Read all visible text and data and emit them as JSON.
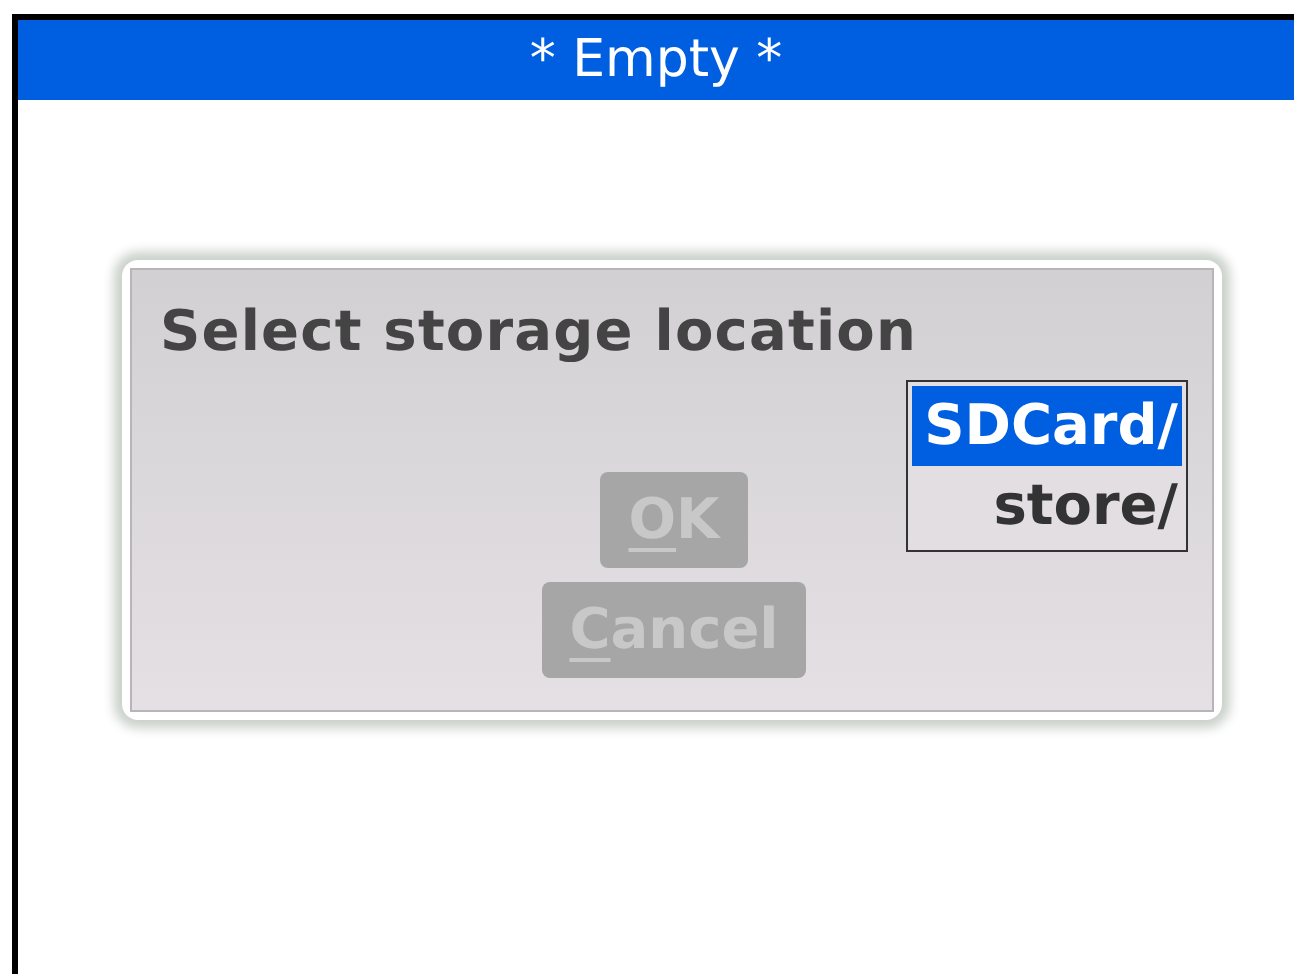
{
  "window": {
    "title": "* Empty *"
  },
  "dialog": {
    "title": "Select storage location",
    "buttons": [
      {
        "mnemonic": "O",
        "rest": "K",
        "disabled": true
      },
      {
        "mnemonic": "C",
        "rest": "ancel",
        "disabled": true
      }
    ],
    "locations": [
      {
        "label": "SDCard/",
        "selected": true
      },
      {
        "label": "store/",
        "selected": false
      }
    ]
  }
}
